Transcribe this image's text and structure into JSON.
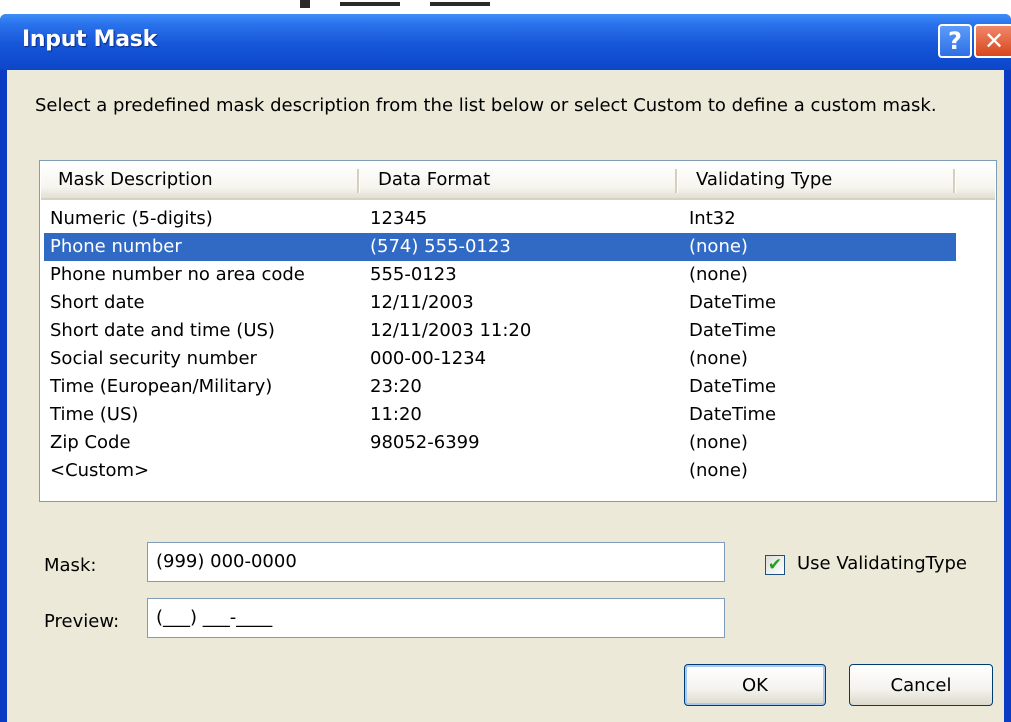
{
  "window": {
    "title": "Input Mask",
    "help_glyph": "?",
    "close_glyph": "✕"
  },
  "instructions": "Select a predefined mask description from the list below or select Custom to define a custom mask.",
  "list": {
    "columns": [
      "Mask Description",
      "Data Format",
      "Validating Type"
    ],
    "selected_index": 1,
    "rows": [
      [
        "Numeric (5-digits)",
        "12345",
        "Int32"
      ],
      [
        "Phone number",
        "(574) 555-0123",
        "(none)"
      ],
      [
        "Phone number no area code",
        "555-0123",
        "(none)"
      ],
      [
        "Short date",
        "12/11/2003",
        "DateTime"
      ],
      [
        "Short date and time (US)",
        "12/11/2003 11:20",
        "DateTime"
      ],
      [
        "Social security number",
        "000-00-1234",
        "(none)"
      ],
      [
        "Time (European/Military)",
        "23:20",
        "DateTime"
      ],
      [
        "Time (US)",
        "11:20",
        "DateTime"
      ],
      [
        "Zip Code",
        "98052-6399",
        "(none)"
      ],
      [
        "<Custom>",
        "",
        "(none)"
      ]
    ]
  },
  "mask": {
    "label": "Mask:",
    "value": "(999) 000-0000"
  },
  "preview": {
    "label": "Preview:",
    "value": "(___) ___-____"
  },
  "use_validating_type": {
    "label": "Use ValidatingType",
    "checked": true,
    "check_glyph": "✔"
  },
  "buttons": {
    "ok": "OK",
    "cancel": "Cancel"
  },
  "colors": {
    "titlebar": "#0c46c9",
    "selection": "#316ac5",
    "dialog_face": "#ece9d8"
  }
}
